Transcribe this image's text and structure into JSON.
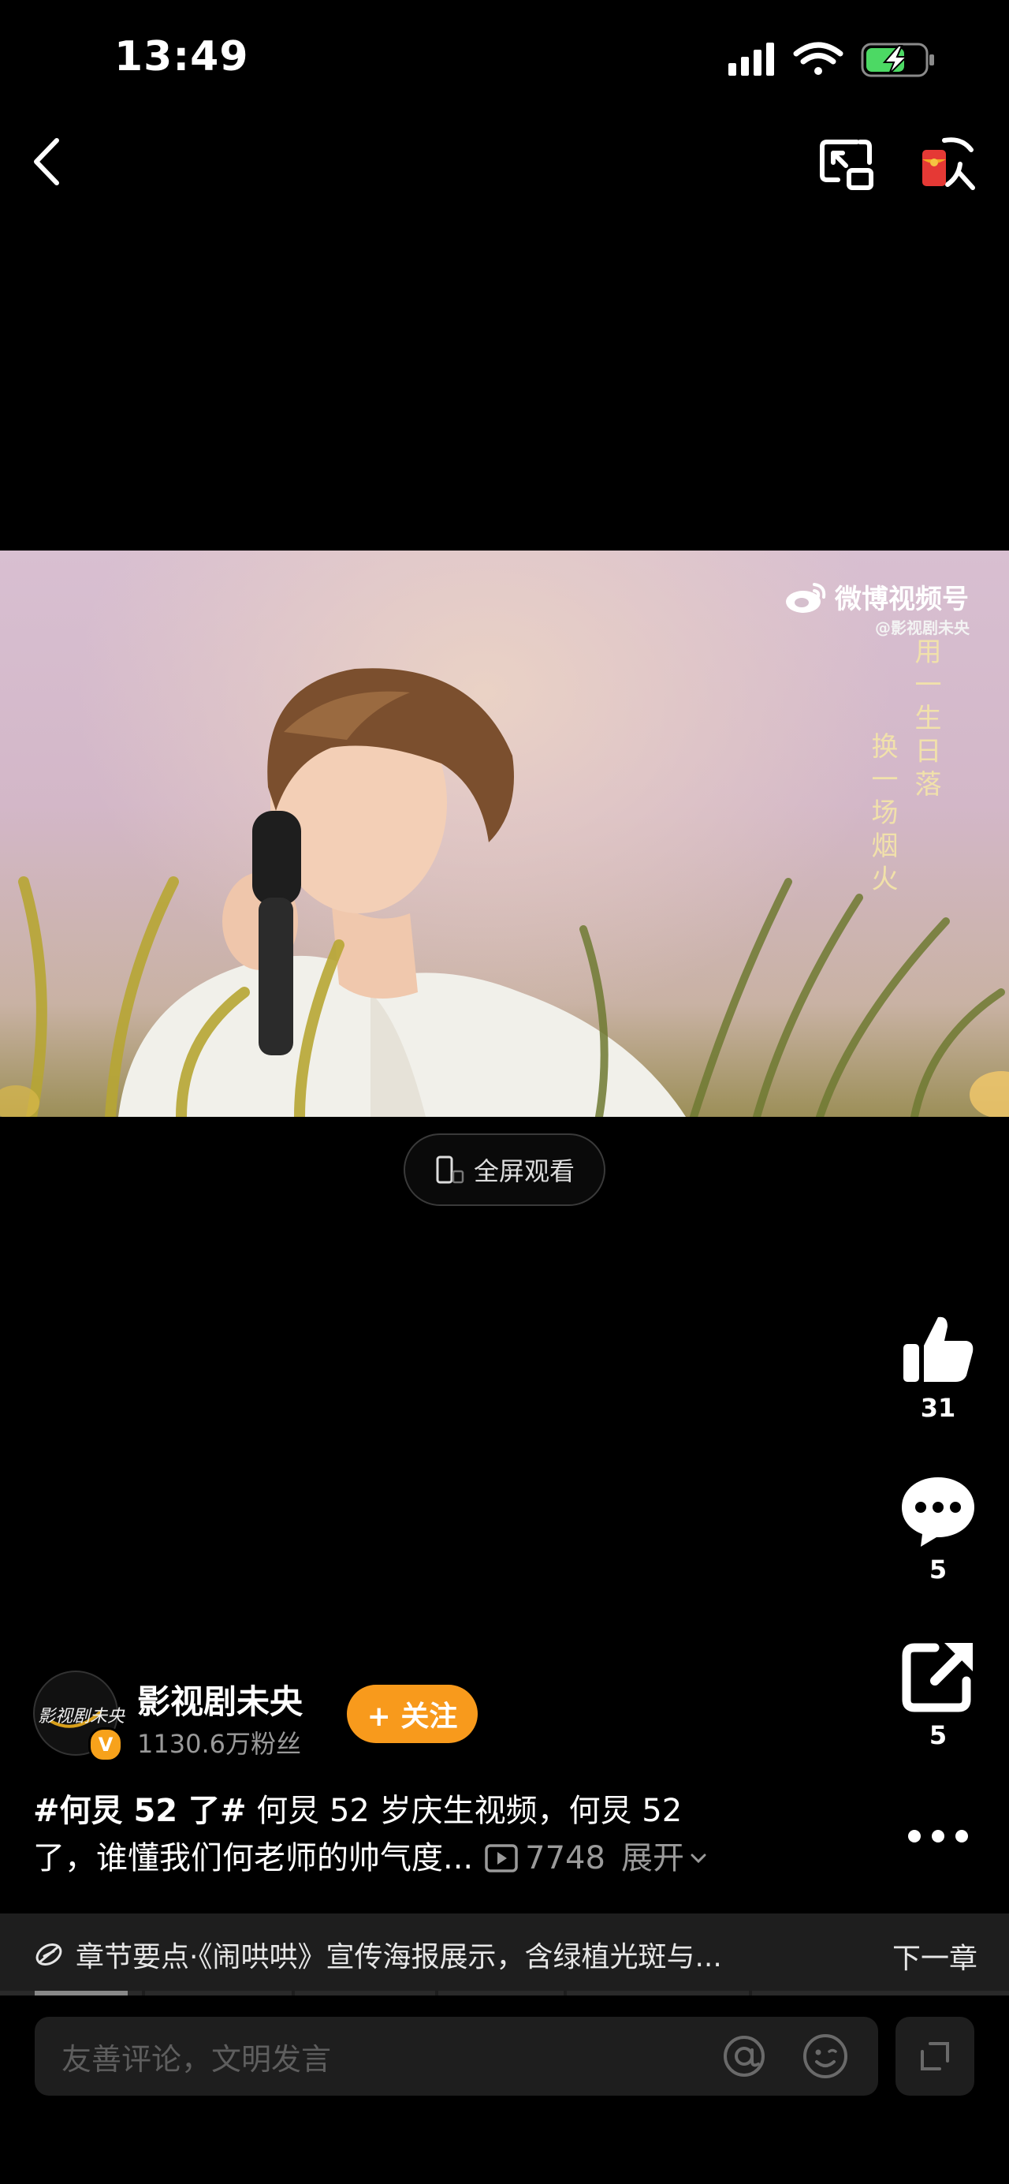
{
  "status_bar": {
    "time": "13:49",
    "icons": [
      "signal-icon",
      "wifi-icon",
      "battery-charging-icon"
    ],
    "battery_color": "#4cd964"
  },
  "nav": {
    "icons": [
      "back-icon",
      "picture-in-picture-icon",
      "red-packet-icon"
    ]
  },
  "video": {
    "watermark": "微博视频号",
    "watermark_sub": "@影视剧未央",
    "lyric_line1": "用一生日落",
    "lyric_line2": "换一场烟火",
    "fullscreen_label": "全屏观看"
  },
  "actions": {
    "like_count": "31",
    "comment_count": "5",
    "share_count": "5",
    "icons": [
      "thumbs-up-icon",
      "comment-bubble-icon",
      "share-icon",
      "more-dots-icon"
    ]
  },
  "author": {
    "avatar_text": "影视剧未央",
    "name": "影视剧未央",
    "fans": "1130.6万粉丝",
    "follow_label": "+ 关注",
    "verified_label": "V",
    "accent_color": "#f89a1c"
  },
  "caption": {
    "tag": "#何炅 52 了#",
    "line1_rest": " 何炅 52 岁庆生视频，何炅 52",
    "line2": "了，谁懂我们何老师的帅气度...",
    "play_count": "7748",
    "expand_label": "展开"
  },
  "chapter": {
    "text": "章节要点·《闹哄哄》宣传海报展示，含绿植光斑与...",
    "next_label": "下一章"
  },
  "comment_bar": {
    "placeholder": "友善评论，文明发言"
  }
}
